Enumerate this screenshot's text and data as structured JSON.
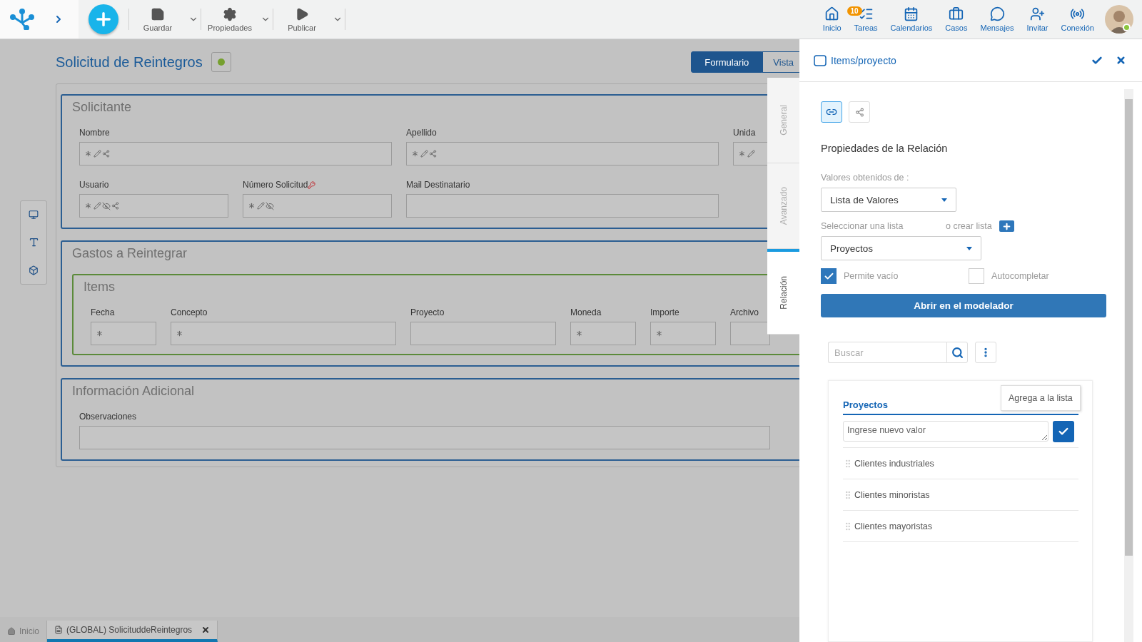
{
  "toolbar": {
    "actions": [
      {
        "label": "Guardar",
        "kind": "save",
        "menu": true
      },
      {
        "label": "Propiedades",
        "kind": "settings",
        "menu": true
      },
      {
        "label": "Publicar",
        "kind": "publish",
        "menu": true
      }
    ],
    "nav": [
      {
        "label": "Inicio",
        "kind": "home"
      },
      {
        "label": "Tareas",
        "kind": "tasks",
        "badge": "10"
      },
      {
        "label": "Calendarios",
        "kind": "calendar"
      },
      {
        "label": "Casos",
        "kind": "cases"
      },
      {
        "label": "Mensajes",
        "kind": "messages"
      },
      {
        "label": "Invitar",
        "kind": "invite"
      },
      {
        "label": "Conexión",
        "kind": "connection"
      }
    ],
    "user": {
      "online": true
    }
  },
  "form": {
    "title": "Solicitud de Reintegros",
    "view_tabs": [
      {
        "label": "Formulario",
        "selected": true
      },
      {
        "label": "Vista",
        "selected": false
      }
    ],
    "sections": [
      {
        "title": "Solicitante",
        "kind": "fields",
        "fields": [
          {
            "label": "Nombre",
            "required": true,
            "editable": true,
            "hidden": false,
            "relation": true,
            "key": false
          },
          {
            "label": "Apellido",
            "required": true,
            "editable": true,
            "hidden": false,
            "relation": true,
            "key": false
          },
          {
            "label": "Unida",
            "required": true,
            "editable": true,
            "hidden": false,
            "relation": false,
            "key": false
          },
          {
            "label": "Usuario",
            "required": true,
            "editable": true,
            "hidden": true,
            "relation": true,
            "key": false
          },
          {
            "label": "Número Solicitud",
            "required": true,
            "editable": true,
            "hidden": true,
            "relation": false,
            "key": true
          },
          {
            "label": "Mail Destinatario",
            "required": false,
            "editable": false,
            "hidden": false,
            "relation": false,
            "key": false
          }
        ]
      },
      {
        "title": "Gastos a Reintegrar",
        "kind": "grid",
        "grid": {
          "title": "Items",
          "columns": [
            {
              "label": "Fecha",
              "required": true,
              "editable": false,
              "hidden": false,
              "relation": false,
              "key": false
            },
            {
              "label": "Concepto",
              "required": true,
              "editable": false,
              "hidden": false,
              "relation": false,
              "key": false
            },
            {
              "label": "Proyecto",
              "required": false,
              "editable": false,
              "hidden": false,
              "relation": false,
              "key": false
            },
            {
              "label": "Moneda",
              "required": true,
              "editable": false,
              "hidden": false,
              "relation": false,
              "key": false
            },
            {
              "label": "Importe",
              "required": true,
              "editable": false,
              "hidden": false,
              "relation": false,
              "key": false
            },
            {
              "label": "Archivo",
              "required": false,
              "editable": false,
              "hidden": false,
              "relation": false,
              "key": false
            }
          ]
        }
      },
      {
        "title": "Información Adicional",
        "kind": "fields",
        "fields": [
          {
            "label": "Observaciones",
            "required": false,
            "editable": false,
            "hidden": false,
            "relation": false,
            "key": false
          }
        ]
      }
    ]
  },
  "side_tabs": [
    {
      "label": "General",
      "selected": false
    },
    {
      "label": "Avanzado",
      "selected": false
    },
    {
      "label": "Relación",
      "selected": true
    }
  ],
  "panel": {
    "title": "Items/proyecto",
    "icon_tabs": [
      {
        "kind": "link",
        "selected": true
      },
      {
        "kind": "nodes",
        "selected": false
      }
    ],
    "heading": "Propiedades de la Relación",
    "source_label": "Valores obtenidos de :",
    "source_value": "Lista de Valores",
    "list_label": "Seleccionar una lista",
    "create_label": "o crear lista",
    "list_value": "Proyectos",
    "options": [
      {
        "label": "Permite vacío",
        "checked": true
      },
      {
        "label": "Autocompletar",
        "checked": false
      }
    ],
    "open_button": "Abrir en el modelador",
    "search": {
      "placeholder": "Buscar"
    },
    "list": {
      "title": "Proyectos",
      "input_placeholder": "Ingrese nuevo valor",
      "tooltip": "Agrega a la lista",
      "items": [
        "Clientes industriales",
        "Clientes minoristas",
        "Clientes mayoristas"
      ]
    }
  },
  "bottom_tabs": [
    {
      "label": "Inicio",
      "kind": "home",
      "selected": false,
      "closable": false
    },
    {
      "label": "(GLOBAL) SolicituddeReintegros",
      "kind": "form",
      "selected": true,
      "closable": true
    }
  ]
}
